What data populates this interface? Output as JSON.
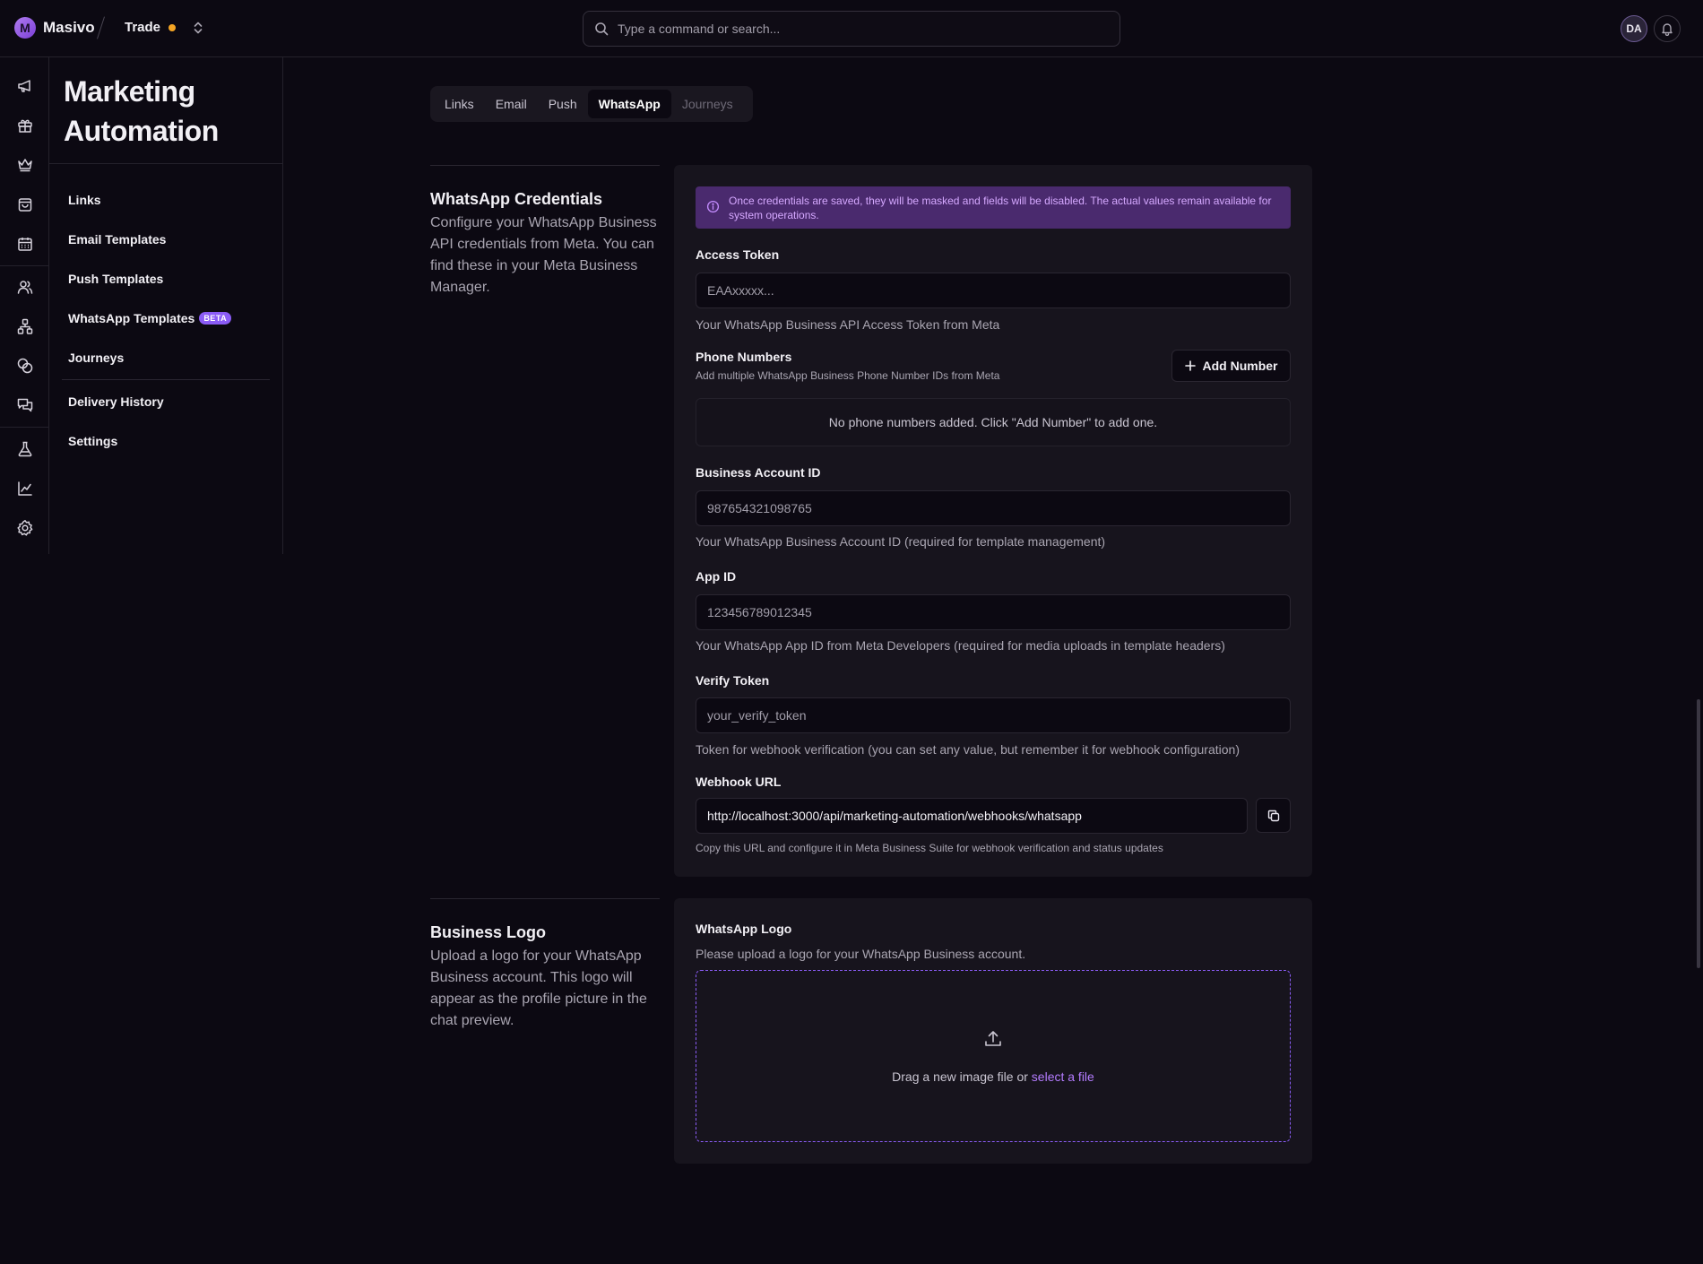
{
  "app": {
    "brand_name": "Masivo",
    "brand_initial": "M",
    "workspace": "Trade",
    "workspace_status_color": "#f5a524"
  },
  "search": {
    "placeholder": "Type a command or search..."
  },
  "user": {
    "initials": "DA"
  },
  "rail_icons": [
    "megaphone-icon",
    "gift-icon",
    "crown-icon",
    "shopping-bag-icon",
    "calendar-icon",
    "users-icon",
    "network-icon",
    "coins-icon",
    "messages-icon",
    "flask-icon",
    "chart-line-icon",
    "gear-icon"
  ],
  "sidebar": {
    "title": "Marketing Automation",
    "items": [
      {
        "label": "Links"
      },
      {
        "label": "Email Templates"
      },
      {
        "label": "Push Templates"
      },
      {
        "label": "WhatsApp Templates",
        "badge": "BETA"
      },
      {
        "label": "Journeys"
      },
      {
        "label": "Delivery History"
      },
      {
        "label": "Settings"
      }
    ]
  },
  "tabs": [
    {
      "label": "Links",
      "state": "default"
    },
    {
      "label": "Email",
      "state": "default"
    },
    {
      "label": "Push",
      "state": "default"
    },
    {
      "label": "WhatsApp",
      "state": "active"
    },
    {
      "label": "Journeys",
      "state": "disabled"
    }
  ],
  "credentials": {
    "title": "WhatsApp Credentials",
    "description": "Configure your WhatsApp Business API credentials from Meta. You can find these in your Meta Business Manager.",
    "alert": "Once credentials are saved, they will be masked and fields will be disabled. The actual values remain available for system operations.",
    "access_token": {
      "label": "Access Token",
      "placeholder": "EAAxxxxx...",
      "help": "Your WhatsApp Business API Access Token from Meta"
    },
    "phone_numbers": {
      "label": "Phone Numbers",
      "help": "Add multiple WhatsApp Business Phone Number IDs from Meta",
      "add_button": "Add Number",
      "empty": "No phone numbers added. Click \"Add Number\" to add one."
    },
    "business_account_id": {
      "label": "Business Account ID",
      "placeholder": "987654321098765",
      "help": "Your WhatsApp Business Account ID (required for template management)"
    },
    "app_id": {
      "label": "App ID",
      "placeholder": "123456789012345",
      "help": "Your WhatsApp App ID from Meta Developers (required for media uploads in template headers)"
    },
    "verify_token": {
      "label": "Verify Token",
      "placeholder": "your_verify_token",
      "help": "Token for webhook verification (you can set any value, but remember it for webhook configuration)"
    },
    "webhook_url": {
      "label": "Webhook URL",
      "value": "http://localhost:3000/api/marketing-automation/webhooks/whatsapp",
      "help": "Copy this URL and configure it in Meta Business Suite for webhook verification and status updates"
    }
  },
  "logo": {
    "title": "Business Logo",
    "description": "Upload a logo for your WhatsApp Business account. This logo will appear as the profile picture in the chat preview.",
    "field_label": "WhatsApp Logo",
    "field_help": "Please upload a logo for your WhatsApp Business account.",
    "drop_text": "Drag a new image file or",
    "select_link": "select a file"
  },
  "colors": {
    "accent": "#8b5cf6",
    "alert_bg": "#4a2a6e",
    "alert_text": "#d5a8ff",
    "background": "#0c0912",
    "card": "#17141d"
  }
}
